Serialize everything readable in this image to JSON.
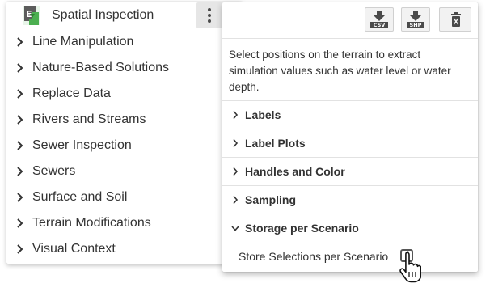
{
  "header": {
    "title": "Spatial Inspection",
    "icon": "spatial-inspection-app-icon",
    "menu_icon": "more-vert-icon"
  },
  "tools": [
    {
      "label": "Line Manipulation"
    },
    {
      "label": "Nature-Based Solutions"
    },
    {
      "label": "Replace Data"
    },
    {
      "label": "Rivers and Streams"
    },
    {
      "label": "Sewer Inspection"
    },
    {
      "label": "Sewers"
    },
    {
      "label": "Surface and Soil"
    },
    {
      "label": "Terrain Modifications"
    },
    {
      "label": "Visual Context"
    }
  ],
  "toolbar": {
    "csv_label": "CSV",
    "shp_label": "SHP",
    "csv_icon": "download-csv-icon",
    "shp_icon": "download-shp-icon",
    "delete_icon": "trash-icon"
  },
  "description": "Select positions on the terrain to extract simulation values such as water level or water depth.",
  "sections": [
    {
      "label": "Labels",
      "expanded": false
    },
    {
      "label": "Label Plots",
      "expanded": false
    },
    {
      "label": "Handles and Color",
      "expanded": false
    },
    {
      "label": "Sampling",
      "expanded": false
    },
    {
      "label": "Storage per Scenario",
      "expanded": true
    }
  ],
  "storage_option": {
    "label": "Store Selections per Scenario",
    "checked": false
  },
  "colors": {
    "accent_green": "#4caf50",
    "icon_dark": "#4a4a4a",
    "divider": "#e2e2e2"
  }
}
